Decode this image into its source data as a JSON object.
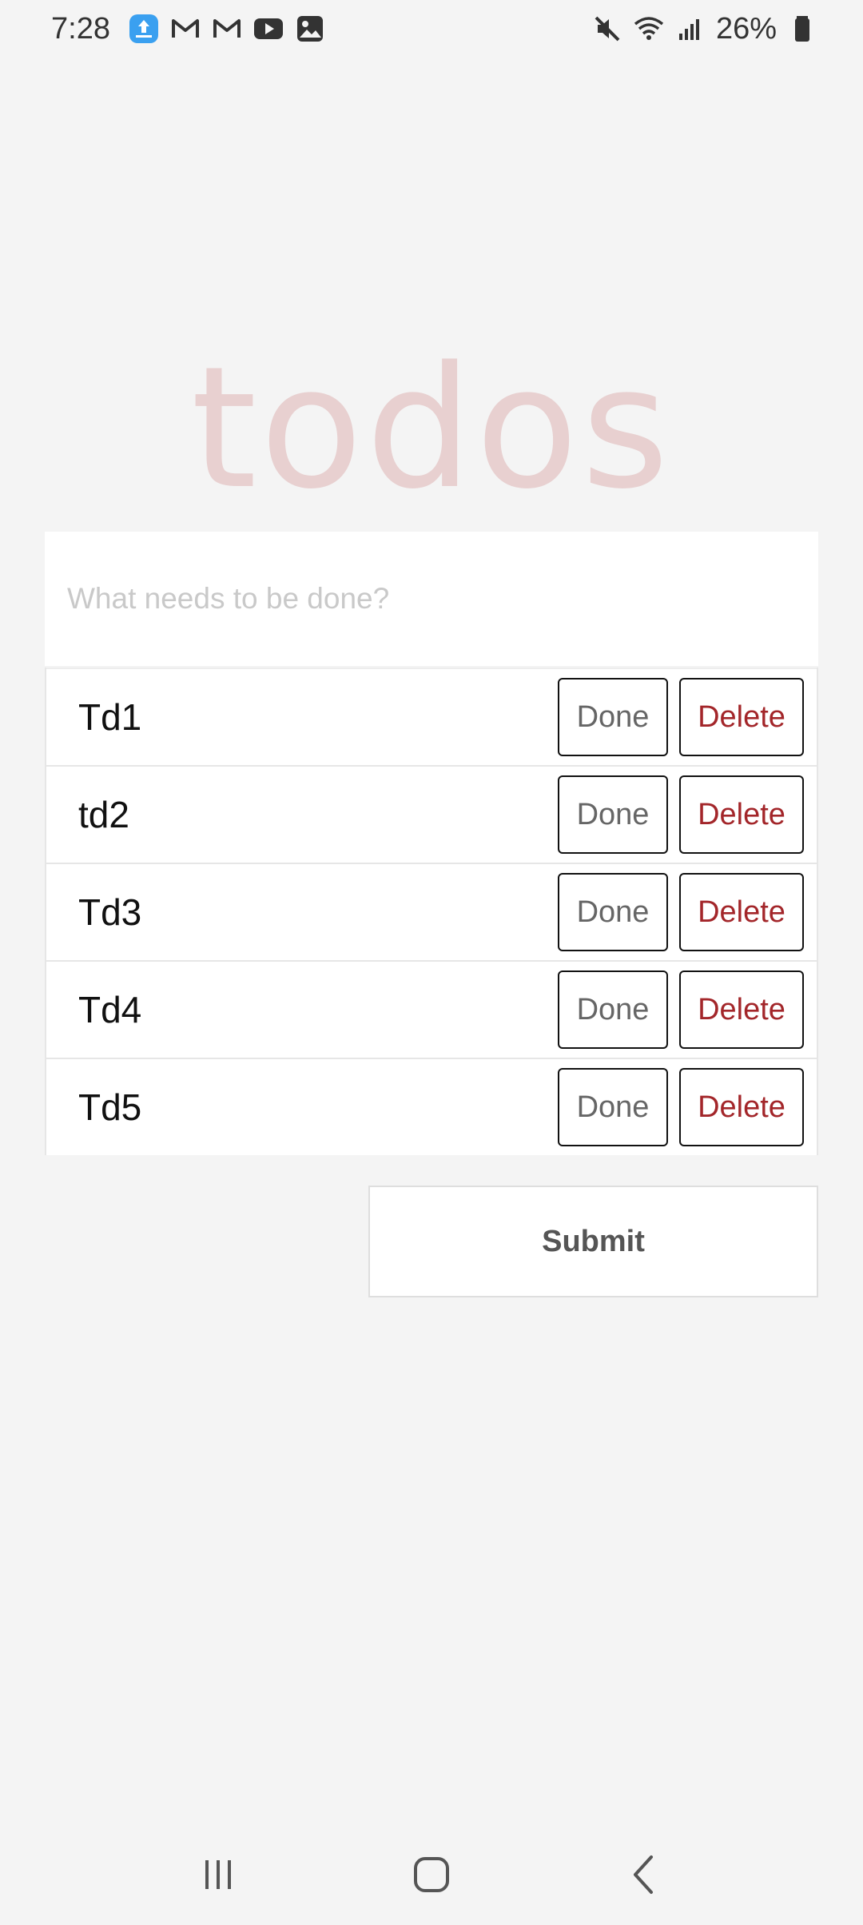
{
  "status_bar": {
    "time": "7:28",
    "battery_percent": "26%",
    "left_icons": [
      "cloud-upload-app-icon",
      "gmail-icon",
      "gmail-icon",
      "youtube-icon",
      "gallery-icon"
    ],
    "right_icons": [
      "mute-icon",
      "wifi-icon",
      "signal-icon",
      "battery-icon"
    ]
  },
  "app": {
    "title": "todos",
    "input_placeholder": "What needs to be done?",
    "input_value": "",
    "title_color": "#e6c5c5",
    "delete_color": "#a3262a"
  },
  "todos": [
    {
      "label": "Td1",
      "done_label": "Done",
      "delete_label": "Delete"
    },
    {
      "label": "td2",
      "done_label": "Done",
      "delete_label": "Delete"
    },
    {
      "label": "Td3",
      "done_label": "Done",
      "delete_label": "Delete"
    },
    {
      "label": "Td4",
      "done_label": "Done",
      "delete_label": "Delete"
    },
    {
      "label": "Td5",
      "done_label": "Done",
      "delete_label": "Delete"
    }
  ],
  "submit_label": "Submit",
  "nav": {
    "icons": [
      "recent-apps-icon",
      "home-icon",
      "back-icon"
    ]
  }
}
